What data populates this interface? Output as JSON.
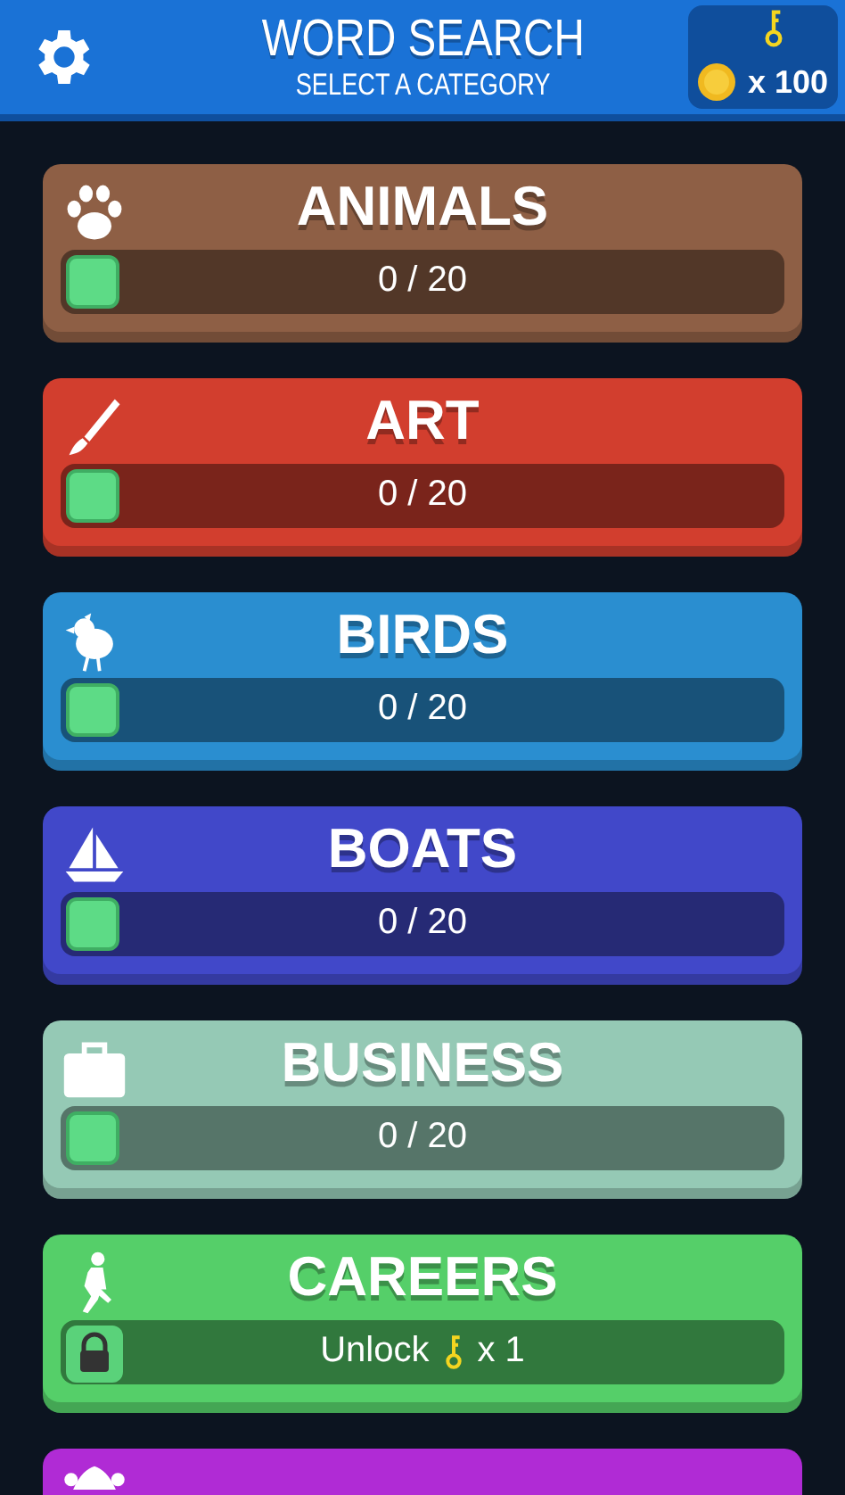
{
  "header": {
    "title": "WORD SEARCH",
    "subtitle": "SELECT A CATEGORY",
    "coins": "x 100"
  },
  "categories": [
    {
      "name": "ANIMALS",
      "kind": "progress",
      "progress": "0 / 20",
      "level": 0,
      "color": "#8e5f45"
    },
    {
      "name": "ART",
      "kind": "progress",
      "progress": "0 / 20",
      "level": 0,
      "color": "#d23e2e"
    },
    {
      "name": "BIRDS",
      "kind": "progress",
      "progress": "0 / 20",
      "level": 0,
      "color": "#2a8ed0"
    },
    {
      "name": "BOATS",
      "kind": "progress",
      "progress": "0 / 20",
      "level": 0,
      "color": "#4148c9"
    },
    {
      "name": "BUSINESS",
      "kind": "progress",
      "progress": "0 / 20",
      "level": 0,
      "color": "#95c9b5"
    },
    {
      "name": "CAREERS",
      "kind": "locked",
      "unlock": "Unlock",
      "cost": "x 1",
      "color": "#55cf69"
    },
    {
      "kind": "partial",
      "color": "#b02bd5"
    }
  ]
}
